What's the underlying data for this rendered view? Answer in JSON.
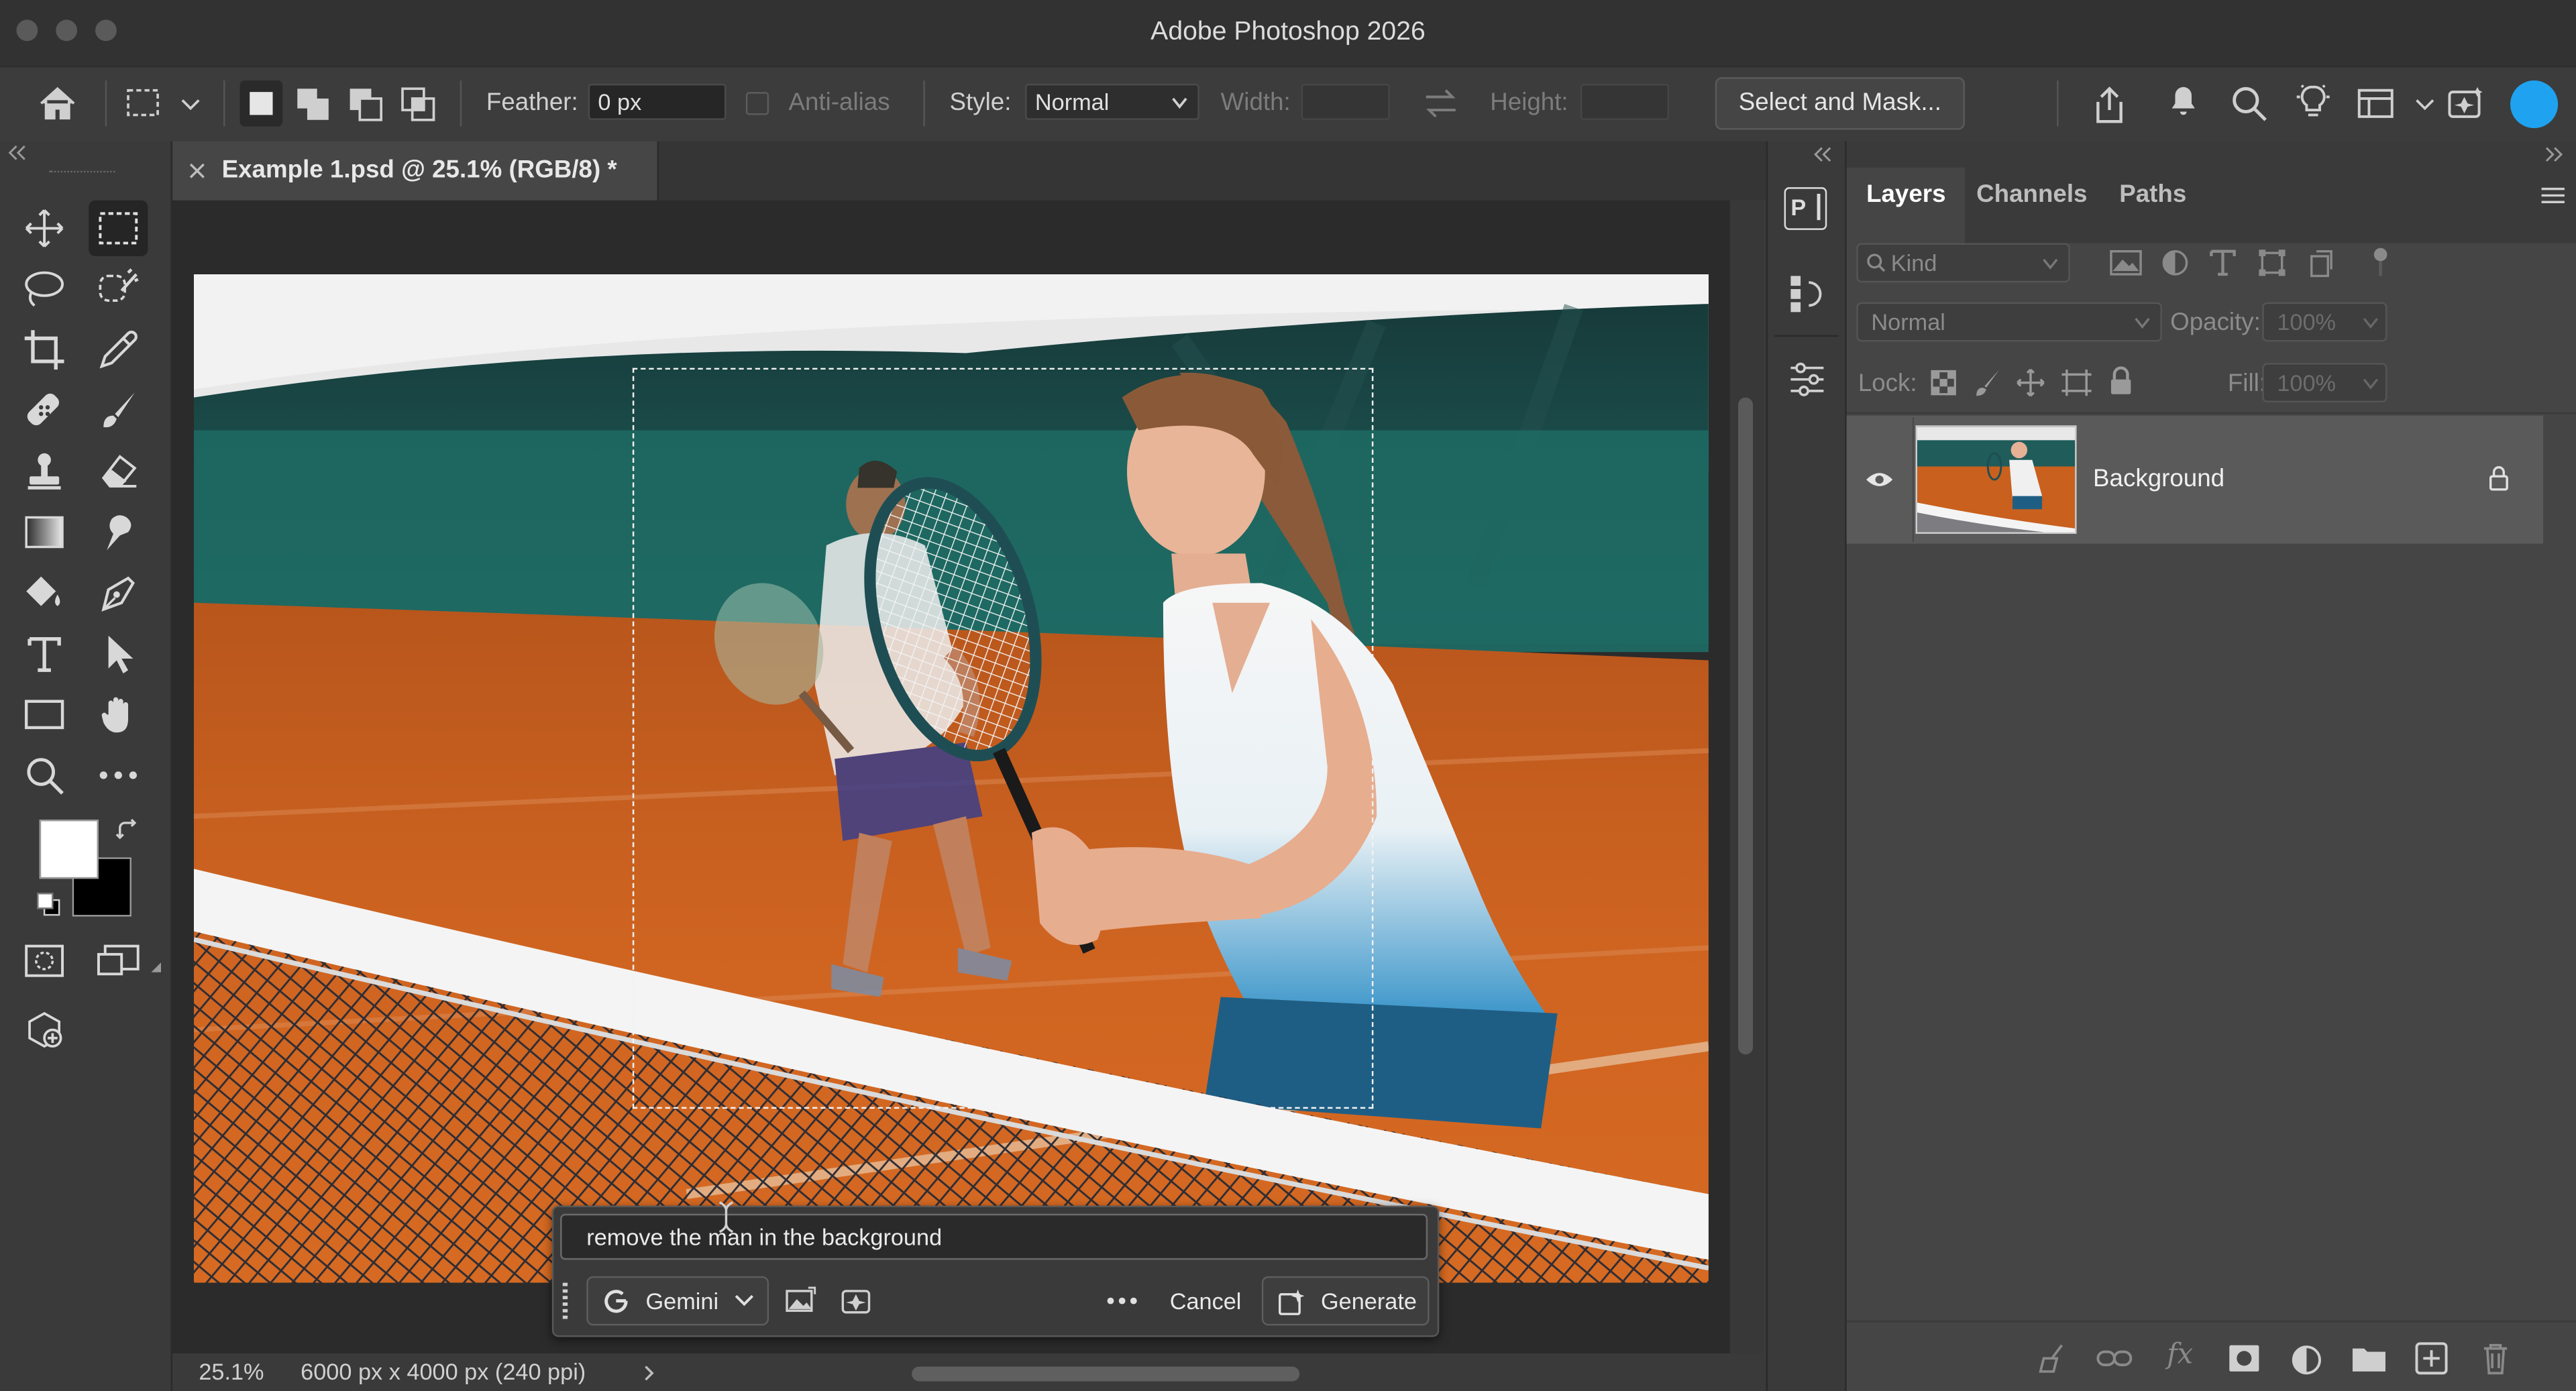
{
  "window": {
    "title": "Adobe Photoshop 2026"
  },
  "options_bar": {
    "feather_label": "Feather:",
    "feather_value": "0 px",
    "antialias_label": "Anti-alias",
    "style_label": "Style:",
    "style_value": "Normal",
    "width_label": "Width:",
    "height_label": "Height:",
    "select_mask_label": "Select and Mask..."
  },
  "document": {
    "tab_label": "Example 1.psd @ 25.1% (RGB/8) *",
    "zoom": "25.1%",
    "dimensions": "6000 px x 4000 px (240 ppi)"
  },
  "layers_panel": {
    "tabs": [
      "Layers",
      "Channels",
      "Paths"
    ],
    "filter_placeholder": "Kind",
    "blend_mode": "Normal",
    "opacity_label": "Opacity:",
    "opacity_value": "100%",
    "lock_label": "Lock:",
    "fill_label": "Fill:",
    "fill_value": "100%",
    "layers": [
      {
        "name": "Background",
        "visible": true,
        "locked": true
      }
    ]
  },
  "generative_bar": {
    "prompt": "remove the man in the background",
    "model": "Gemini",
    "cancel_label": "Cancel",
    "generate_label": "Generate"
  },
  "colors": {
    "accent": "#1fa3f0",
    "court_orange": "#c9601e",
    "wall_teal": "#1e5c58",
    "foreground_swatch": "#ffffff",
    "background_swatch": "#000000"
  },
  "icons": {
    "toolbar": [
      "move-icon",
      "rectangular-marquee-icon",
      "lasso-icon",
      "object-selection-icon",
      "crop-icon",
      "eyedropper-icon",
      "healing-brush-icon",
      "brush-icon",
      "clone-stamp-icon",
      "eraser-icon",
      "gradient-icon",
      "smudge-icon",
      "paint-bucket-icon",
      "pen-icon",
      "type-icon",
      "path-selection-icon",
      "rectangle-icon",
      "hand-icon",
      "zoom-icon",
      "more-tools-icon"
    ]
  }
}
